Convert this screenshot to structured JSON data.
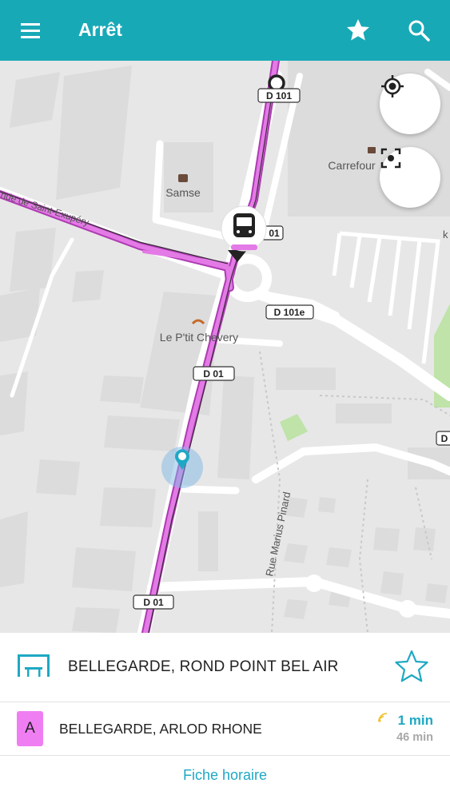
{
  "appbar": {
    "title": "Arrêt",
    "menu_icon": "menu-icon",
    "favorite_icon": "star-icon",
    "search_icon": "search-icon",
    "color": "#18a9b7"
  },
  "map": {
    "road_labels": [
      "D 101",
      "D 01",
      "D 101e",
      "D 01",
      "D 01",
      "D"
    ],
    "poi_labels": [
      "Samse",
      "Carrefour",
      "Le P'tit Chevery",
      "Rue Marius Pinard",
      "nde de Saint-Exupéry",
      "k"
    ],
    "route_color": "#e37ae6",
    "locate_icon": "crosshair-icon",
    "focus_icon": "focus-frame-icon"
  },
  "stop": {
    "name": "BELLEGARDE, ROND POINT BEL AIR",
    "icon": "bus-shelter-icon",
    "favorite_icon": "star-outline-icon"
  },
  "departure": {
    "line": "A",
    "line_color": "#f07ef3",
    "destination": "BELLEGARDE, ARLOD RHONE",
    "next": "1 min",
    "following": "46 min",
    "realtime_icon": "realtime-signal-icon"
  },
  "schedule_link": "Fiche horaire"
}
